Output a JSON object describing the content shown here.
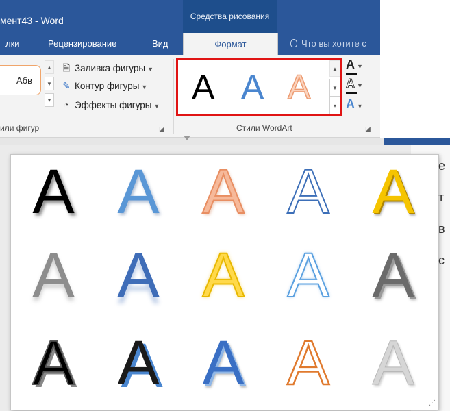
{
  "window": {
    "title": "мент43 - Word",
    "context_group": "Средства рисования"
  },
  "tabs": [
    {
      "label": "лки"
    },
    {
      "label": "Рецензирование"
    },
    {
      "label": "Вид"
    },
    {
      "label": "Формат",
      "active": true
    }
  ],
  "tell_me": "Что вы хотите с",
  "shape_styles": {
    "sample_text": "Абв",
    "fill_label": "Заливка фигуры",
    "outline_label": "Контур фигуры",
    "effects_label": "Эффекты фигуры",
    "group_label": "или фигур"
  },
  "wordart": {
    "group_label": "Стили WordArt",
    "inline_glyph": "A",
    "highlight_color": "#e01414"
  },
  "text_tools": {
    "fill_glyph": "A",
    "outline_glyph": "A",
    "effects_glyph": "A"
  },
  "gallery": {
    "glyph": "A",
    "rows": [
      [
        "black-shadow",
        "blue-gradient",
        "orange-soft-shadow",
        "white-blue-outline",
        "gold-bevel"
      ],
      [
        "gray-reflection",
        "blue-reflection",
        "gold-glow",
        "light-blue-outline",
        "gray-bevel"
      ],
      [
        "black-offset-shadow",
        "black-blue-shadow",
        "blue-3d",
        "orange-outline",
        "silver-gradient"
      ]
    ]
  },
  "colors": {
    "titlebar": "#2b579a",
    "context": "#1e4e8c",
    "ribbon": "#f3f3f3",
    "accent_orange": "#f0a56b",
    "accent_blue": "#4a86cf"
  }
}
